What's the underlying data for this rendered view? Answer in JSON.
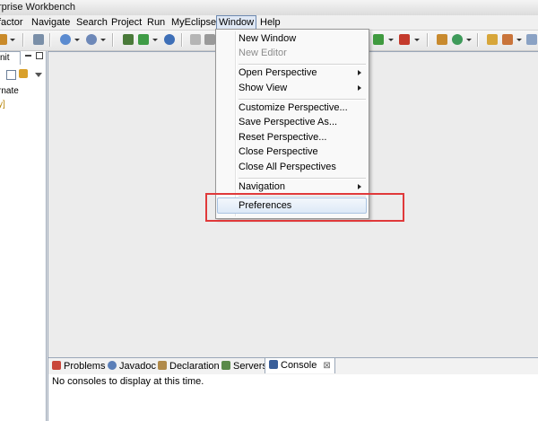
{
  "window": {
    "title": "rprise Workbench"
  },
  "menubar": {
    "items": [
      "factor",
      "Navigate",
      "Search",
      "Project",
      "Run",
      "MyEclipse",
      "Window",
      "Help"
    ],
    "active": "Window"
  },
  "left_panel": {
    "tab_label": "nit",
    "text_1": "rnate",
    "text_2": "y]"
  },
  "window_menu": {
    "new_window": "New Window",
    "new_editor": "New Editor",
    "open_perspective": "Open Perspective",
    "show_view": "Show View",
    "customize_perspective": "Customize Perspective...",
    "save_perspective_as": "Save Perspective As...",
    "reset_perspective": "Reset Perspective...",
    "close_perspective": "Close Perspective",
    "close_all_perspectives": "Close All Perspectives",
    "navigation": "Navigation",
    "preferences": "Preferences"
  },
  "bottom_tabs": {
    "problems": "Problems",
    "javadoc": "Javadoc",
    "declaration": "Declaration",
    "servers": "Servers",
    "console": "Console",
    "close_glyph": "⊠"
  },
  "console": {
    "message": "No consoles to display at this time."
  },
  "colors": {
    "highlight_box": "#e0393a",
    "menu_selection": "#dde9f7",
    "border": "#9aa7b8"
  }
}
